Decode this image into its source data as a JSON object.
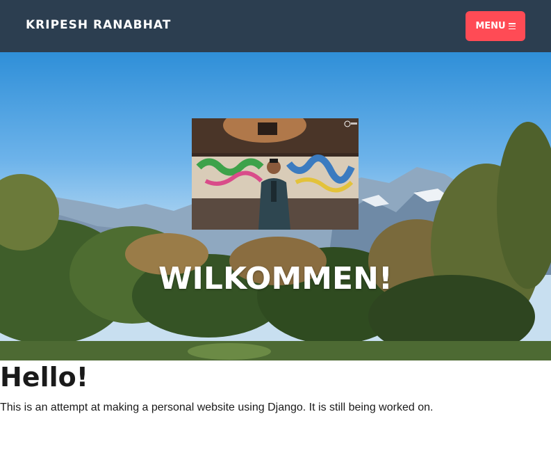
{
  "navbar": {
    "brand": "KRIPESH RANABHAT",
    "menu_label": "MENU",
    "menu_icon": "hamburger-icon"
  },
  "hero": {
    "title": "WILKOMMEN!",
    "background": "mountain-landscape",
    "photo": "profile-photo"
  },
  "content": {
    "title": "Hello!",
    "text": "This is an attempt at making a personal website using Django. It is still being worked on."
  },
  "colors": {
    "navbar": "#2c3e50",
    "menu_button": "#ff4b55",
    "text": "#1a1a1a",
    "hero_text": "#ffffff"
  }
}
